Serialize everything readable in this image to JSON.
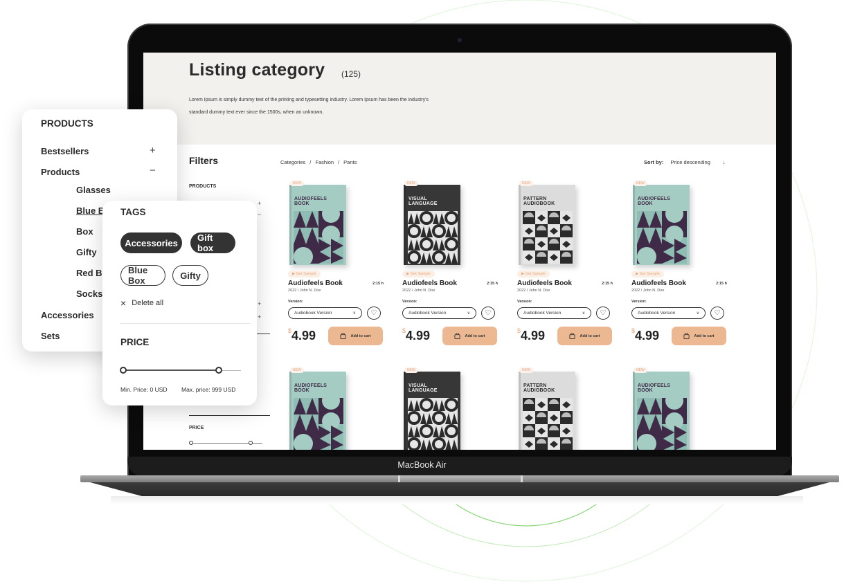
{
  "device": {
    "label": "MacBook Air"
  },
  "colors": {
    "accent": "#ebb892",
    "accent_text": "#e8a87f",
    "dark": "#333333",
    "hero_bg": "#f2f1ee",
    "ring": "#7ed36b"
  },
  "hero": {
    "title": "Listing category",
    "count": "(125)",
    "description": "Lorem Ipsum is simply dummy text of the printing and typesetting industry. Lorem Ipsum has been the industry's standard dummy text ever since the 1500s, when an unknown."
  },
  "filters": {
    "title": "Filters",
    "products_label": "PRODUCTS",
    "price_label": "PRICE",
    "plus_icon": "+",
    "minus_icon": "−"
  },
  "breadcrumb": {
    "items": [
      "Categories",
      "/",
      "Fashion",
      "/",
      "Pants"
    ]
  },
  "sort": {
    "label": "Sort by:",
    "value": "Price descending",
    "arrow_icon": "↓"
  },
  "products": [
    {
      "badge": "NEW",
      "cover_title_1": "AUDIOFEELS",
      "cover_title_2": "BOOK",
      "cover_style": "teal",
      "sample": "▶ Get Sample",
      "title": "Audiofeels Book",
      "duration": "2:15 h",
      "meta": "2022 / John N. Doe",
      "version_label": "Version:",
      "version": "Audiobook Version",
      "currency": "$",
      "price": "4.99",
      "cart": "Add to cart"
    },
    {
      "badge": "NEW",
      "cover_title_1": "VISUAL",
      "cover_title_2": "LANGUAGE",
      "cover_style": "dark",
      "sample": "▶ Get Sample",
      "title": "Audiofeels Book",
      "duration": "2:15 h",
      "meta": "2022 / John N. Doe",
      "version_label": "Version:",
      "version": "Audiobook Version",
      "currency": "$",
      "price": "4.99",
      "cart": "Add to cart"
    },
    {
      "badge": "NEW",
      "cover_title_1": "PATTERN",
      "cover_title_2": "AUDIOBOOK",
      "cover_style": "grey",
      "sample": "▶ Get Sample",
      "title": "Audiofeels Book",
      "duration": "2:15 h",
      "meta": "2022 / John N. Doe",
      "version_label": "Version:",
      "version": "Audiobook Version",
      "currency": "$",
      "price": "4.99",
      "cart": "Add to cart"
    },
    {
      "badge": "NEW",
      "cover_title_1": "AUDIOFEELS",
      "cover_title_2": "BOOK",
      "cover_style": "teal",
      "sample": "▶ Get Sample",
      "title": "Audiofeels Book",
      "duration": "2:15 h",
      "meta": "2022 / John N. Doe",
      "version_label": "Version:",
      "version": "Audiobook Version",
      "currency": "$",
      "price": "4.99",
      "cart": "Add to cart"
    },
    {
      "badge": "NEW",
      "cover_title_1": "AUDIOFEELS",
      "cover_title_2": "BOOK",
      "cover_style": "teal"
    },
    {
      "badge": "NEW",
      "cover_title_1": "VISUAL",
      "cover_title_2": "LANGUAGE",
      "cover_style": "dark"
    },
    {
      "badge": "NEW",
      "cover_title_1": "PATTERN",
      "cover_title_2": "AUDIOBOOK",
      "cover_style": "grey"
    },
    {
      "badge": "NEW",
      "cover_title_1": "AUDIOFEELS",
      "cover_title_2": "BOOK",
      "cover_style": "teal"
    }
  ],
  "products_panel": {
    "title": "PRODUCTS",
    "items": [
      {
        "label": "Bestsellers",
        "sign": "+"
      },
      {
        "label": "Products",
        "sign": "−"
      },
      {
        "label": "Accessories"
      },
      {
        "label": "Sets"
      }
    ],
    "subitems": [
      "Glasses",
      "Blue Box",
      "Box",
      "Gifty",
      "Red Box",
      "Socks"
    ]
  },
  "tags_panel": {
    "title": "TAGS",
    "active_tags": [
      "Accessories",
      "Gift box"
    ],
    "tags": [
      "Blue Box",
      "Gifty"
    ],
    "delete_all": "Delete all",
    "close_icon": "×",
    "price_title": "PRICE",
    "price_min": "Min. Price: 0 USD",
    "price_max": "Max. price: 999 USD",
    "range_min_fraction": 0,
    "range_max_fraction": 0.82
  }
}
